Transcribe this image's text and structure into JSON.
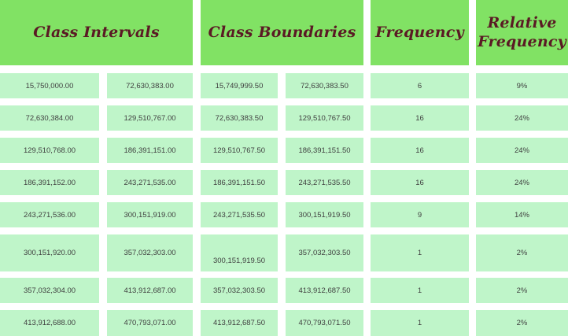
{
  "headers": {
    "class_intervals": "Class Intervals",
    "class_boundaries": "Class Boundaries",
    "frequency": "Frequency",
    "relative_frequency": "Relative\nFrequency"
  },
  "rows": [
    {
      "ci_lower": "15,750,000.00",
      "ci_upper": "72,630,383.00",
      "cb_lower": "15,749,999.50",
      "cb_upper": "72,630,383.50",
      "frequency": "6",
      "relative_frequency": "9%"
    },
    {
      "ci_lower": "72,630,384.00",
      "ci_upper": "129,510,767.00",
      "cb_lower": "72,630,383.50",
      "cb_upper": "129,510,767.50",
      "frequency": "16",
      "relative_frequency": "24%"
    },
    {
      "ci_lower": "129,510,768.00",
      "ci_upper": "186,391,151.00",
      "cb_lower": "129,510,767.50",
      "cb_upper": "186,391,151.50",
      "frequency": "16",
      "relative_frequency": "24%"
    },
    {
      "ci_lower": "186,391,152.00",
      "ci_upper": "243,271,535.00",
      "cb_lower": "186,391,151.50",
      "cb_upper": "243,271,535.50",
      "frequency": "16",
      "relative_frequency": "24%"
    },
    {
      "ci_lower": "243,271,536.00",
      "ci_upper": "300,151,919.00",
      "cb_lower": "243,271,535.50",
      "cb_upper": "300,151,919.50",
      "frequency": "9",
      "relative_frequency": "14%"
    },
    {
      "ci_lower": "300,151,920.00",
      "ci_upper": "357,032,303.00",
      "cb_lower": "300,151,919.50",
      "cb_upper": "357,032,303.50",
      "frequency": "1",
      "relative_frequency": "2%"
    },
    {
      "ci_lower": "357,032,304.00",
      "ci_upper": "413,912,687.00",
      "cb_lower": "357,032,303.50",
      "cb_upper": "413,912,687.50",
      "frequency": "1",
      "relative_frequency": "2%"
    },
    {
      "ci_lower": "413,912,688.00",
      "ci_upper": "470,793,071.00",
      "cb_lower": "413,912,687.50",
      "cb_upper": "470,793,071.50",
      "frequency": "1",
      "relative_frequency": "2%"
    }
  ],
  "colors": {
    "header_bg": "#81e264",
    "header_text": "#5a1a24",
    "cell_bg": "#bff5c9",
    "cell_text": "#3f3f3f"
  }
}
